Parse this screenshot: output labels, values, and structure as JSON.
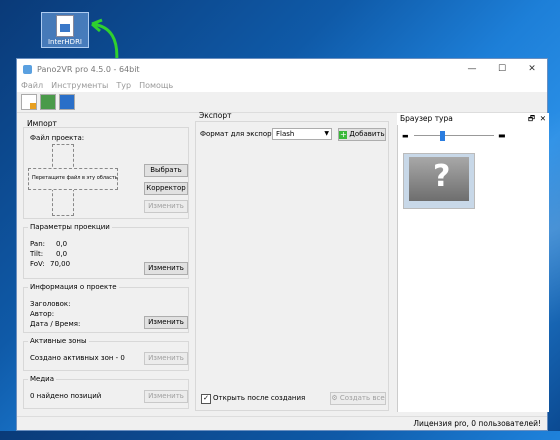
{
  "desktop": {
    "file_label": "InterHDRI"
  },
  "window": {
    "title": "Pano2VR pro 4.5.0 - 64bit",
    "controls": {
      "minimize": "—",
      "maximize": "☐",
      "close": "✕"
    }
  },
  "menu": [
    "Файл",
    "Инструменты",
    "Тур",
    "Помощь"
  ],
  "import": {
    "title": "Импорт",
    "file_label": "Файл проекта:",
    "drop_text": "Перетащите файл в эту область",
    "select_btn": "Выбрать",
    "corrector_btn": "Корректор",
    "change_btn": "Изменить"
  },
  "projection": {
    "title": "Параметры проекции",
    "pan_label": "Pan:",
    "pan_value": "0,0",
    "tilt_label": "Tilt:",
    "tilt_value": "0,0",
    "fov_label": "FoV:",
    "fov_value": "70,00",
    "change_btn": "Изменить"
  },
  "project_info": {
    "title": "Информация о проекте",
    "header_label": "Заголовок:",
    "author_label": "Автор:",
    "datetime_label": "Дата / Время:",
    "change_btn": "Изменить"
  },
  "hotspots": {
    "title": "Активные зоны",
    "status": "Создано активных зон - 0",
    "change_btn": "Изменить"
  },
  "media": {
    "title": "Медиа",
    "status": "0 найдено позиций",
    "change_btn": "Изменить"
  },
  "export": {
    "title": "Экспорт",
    "format_label": "Формат для экспорта:",
    "format_value": "Flash",
    "add_btn": "Добавить",
    "open_after_label": "Открыть после создания",
    "open_after_checked": true,
    "create_all_btn": "Создать все"
  },
  "tour_browser": {
    "title": "Браузер тура",
    "pin": "🗗",
    "close": "✕",
    "zoom_level": 0.35
  },
  "status_bar": {
    "text": "Лицензия pro, 0 пользователей!"
  }
}
